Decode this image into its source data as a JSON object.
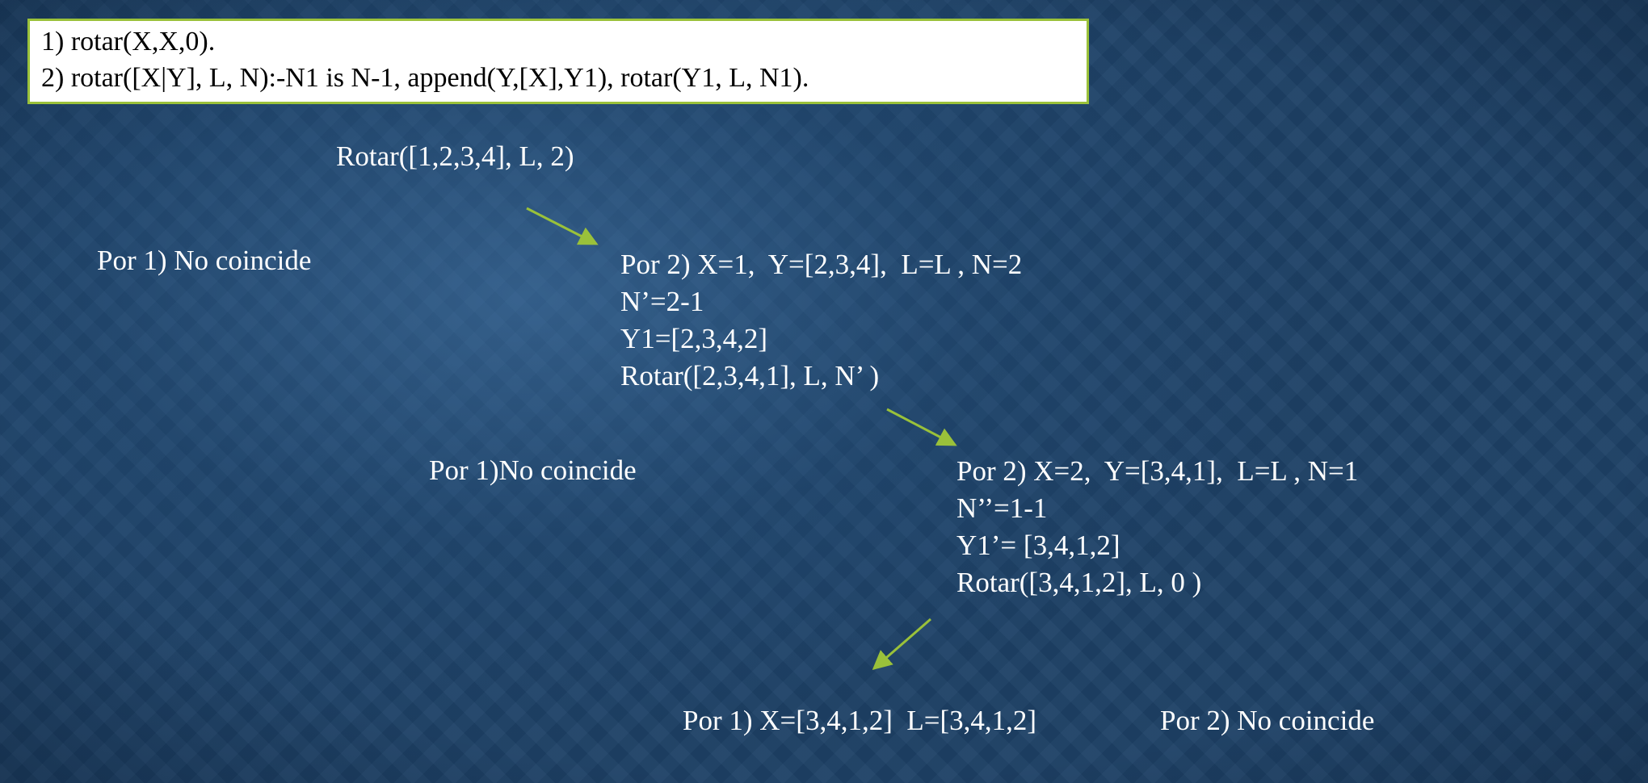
{
  "code_box": {
    "line1": "1) rotar(X,X,0).",
    "line2": "2) rotar([X|Y], L, N):-N1 is N-1, append(Y,[X],Y1), rotar(Y1, L, N1)."
  },
  "query": "Rotar([1,2,3,4], L, 2)",
  "level1": {
    "clause1_result": "Por 1) No coincide",
    "clause2_lines": [
      "Por 2) X=1,  Y=[2,3,4],  L=L , N=2",
      "N’=2-1",
      "Y1=[2,3,4,2]",
      "Rotar([2,3,4,1], L, N’ )"
    ]
  },
  "level2": {
    "clause1_result": "Por 1)No coincide",
    "clause2_lines": [
      "Por 2) X=2,  Y=[3,4,1],  L=L , N=1",
      "N’’=1-1",
      "Y1’= [3,4,1,2]",
      "Rotar([3,4,1,2], L, 0 )"
    ]
  },
  "level3": {
    "clause1_result": "Por 1) X=[3,4,1,2]  L=[3,4,1,2]",
    "clause2_result": "Por 2) No coincide"
  },
  "colors": {
    "arrow": "#9ac13a",
    "box_border": "#9ac13a",
    "background": "#1e4166"
  }
}
